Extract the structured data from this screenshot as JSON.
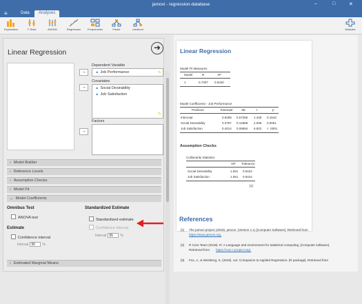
{
  "window": {
    "title": "jamovi - regression-database"
  },
  "menu": {
    "tabs": [
      "Data",
      "Analyses"
    ]
  },
  "toolbar": {
    "buttons": [
      "Exploration",
      "T-Tests",
      "ANOVA",
      "Regression",
      "Frequencies",
      "Factor",
      "medmod"
    ],
    "modules_label": "Modules"
  },
  "options": {
    "title": "Linear Regression",
    "dependent": {
      "label": "Dependent Variable",
      "value": "Job Performance"
    },
    "covariates": {
      "label": "Covariates",
      "items": [
        "Social Desirability",
        "Job Satisfaction"
      ]
    },
    "factors": {
      "label": "Factors"
    },
    "sections": [
      "Model Builder",
      "Reference Levels",
      "Assumption Checks",
      "Model Fit",
      "Model Coefficients",
      "Estimated Marginal Means"
    ],
    "omnibus": {
      "heading": "Omnibus Test",
      "anova": "ANOVA test"
    },
    "estimate": {
      "heading": "Estimate",
      "ci": "Confidence interval",
      "interval_label": "Interval",
      "interval_value": "95",
      "pct": "%"
    },
    "std_estimate": {
      "heading": "Standardized Estimate",
      "std": "Standardized estimate",
      "ci": "Confidence interval",
      "interval_label": "Interval",
      "interval_value": "95",
      "pct": "%"
    }
  },
  "results": {
    "title": "Linear Regression",
    "model_fit": {
      "caption": "Model Fit Measures",
      "headers": [
        "Model",
        "R",
        "R²"
      ],
      "rows": [
        [
          "1",
          "0.7307",
          "0.5340"
        ]
      ]
    },
    "coefficients": {
      "caption": "Model Coefficients - Job Performance",
      "headers": [
        "Predictor",
        "Estimate",
        "SE",
        "t",
        "p"
      ],
      "rows": [
        [
          "Intercept",
          "0.8288",
          "0.57255",
          "1.448",
          "0.1543"
        ],
        [
          "Social Desirability",
          "0.3787",
          "0.12889",
          "2.938",
          "0.0051"
        ],
        [
          "Job Satisfaction",
          "0.4014",
          "0.06894",
          "5.822",
          "< .0001"
        ]
      ]
    },
    "assumption": {
      "title": "Assumption Checks",
      "caption": "Collinearity Statistics",
      "headers": [
        "",
        "VIF",
        "Tolerance"
      ],
      "rows": [
        [
          "Social Desirability",
          "1.061",
          "0.9424"
        ],
        [
          "Job Satisfaction",
          "1.061",
          "0.9424"
        ]
      ]
    },
    "references": {
      "title": "References",
      "items": [
        {
          "num": "[1]",
          "text": "The jamovi project (2019). jamovi. (Version 1.1) [Computer Software]. Retrieved from",
          "link": "https://www.jamovi.org."
        },
        {
          "num": "[2]",
          "text": "R Core Team (2018). R: A Language and environment for statistical computing. [Computer software].",
          "text2": "Retrieved from",
          "link": "https://cran.r-project.org/."
        },
        {
          "num": "[3]",
          "text": "Fox, J., & Weisberg, S. (2018). car: Companion to Applied Regression. [R package]. Retrieved from"
        }
      ]
    }
  },
  "colors": {
    "accent": "#3e6da9",
    "arrow": "#e02020"
  }
}
